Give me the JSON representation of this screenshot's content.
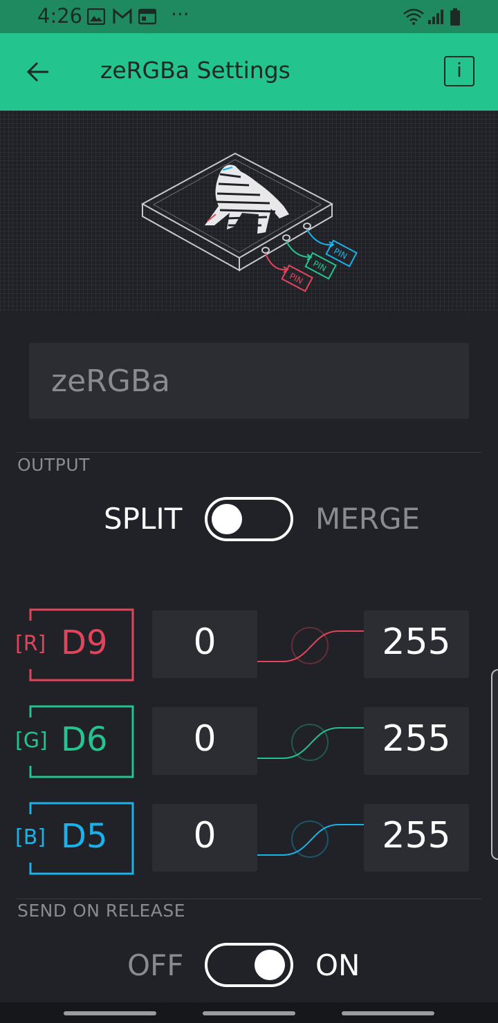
{
  "status_bar": {
    "time": "4:26",
    "icons": [
      "image-icon",
      "gmail-icon",
      "calendar-icon",
      "more-dots-icon",
      "wifi-icon",
      "signal-icon",
      "battery-icon"
    ],
    "more": "···"
  },
  "app_bar": {
    "title": "zeRGBa Settings",
    "info_label": "i",
    "color": "#23c48e"
  },
  "hero": {
    "pin_labels": [
      "PIN",
      "PIN",
      "PIN"
    ]
  },
  "name_input": {
    "value": "zeRGBa"
  },
  "output": {
    "label": "OUTPUT",
    "left": "SPLIT",
    "right": "MERGE",
    "state": "SPLIT"
  },
  "channels": [
    {
      "tag": "[R]",
      "pin": "D9",
      "min": "0",
      "max": "255",
      "color": "#e2455b"
    },
    {
      "tag": "[G]",
      "pin": "D6",
      "min": "0",
      "max": "255",
      "color": "#23c48e"
    },
    {
      "tag": "[B]",
      "pin": "D5",
      "min": "0",
      "max": "255",
      "color": "#1ab2ea"
    }
  ],
  "send_on_release": {
    "label": "SEND ON RELEASE",
    "left": "OFF",
    "right": "ON",
    "state": "ON"
  }
}
